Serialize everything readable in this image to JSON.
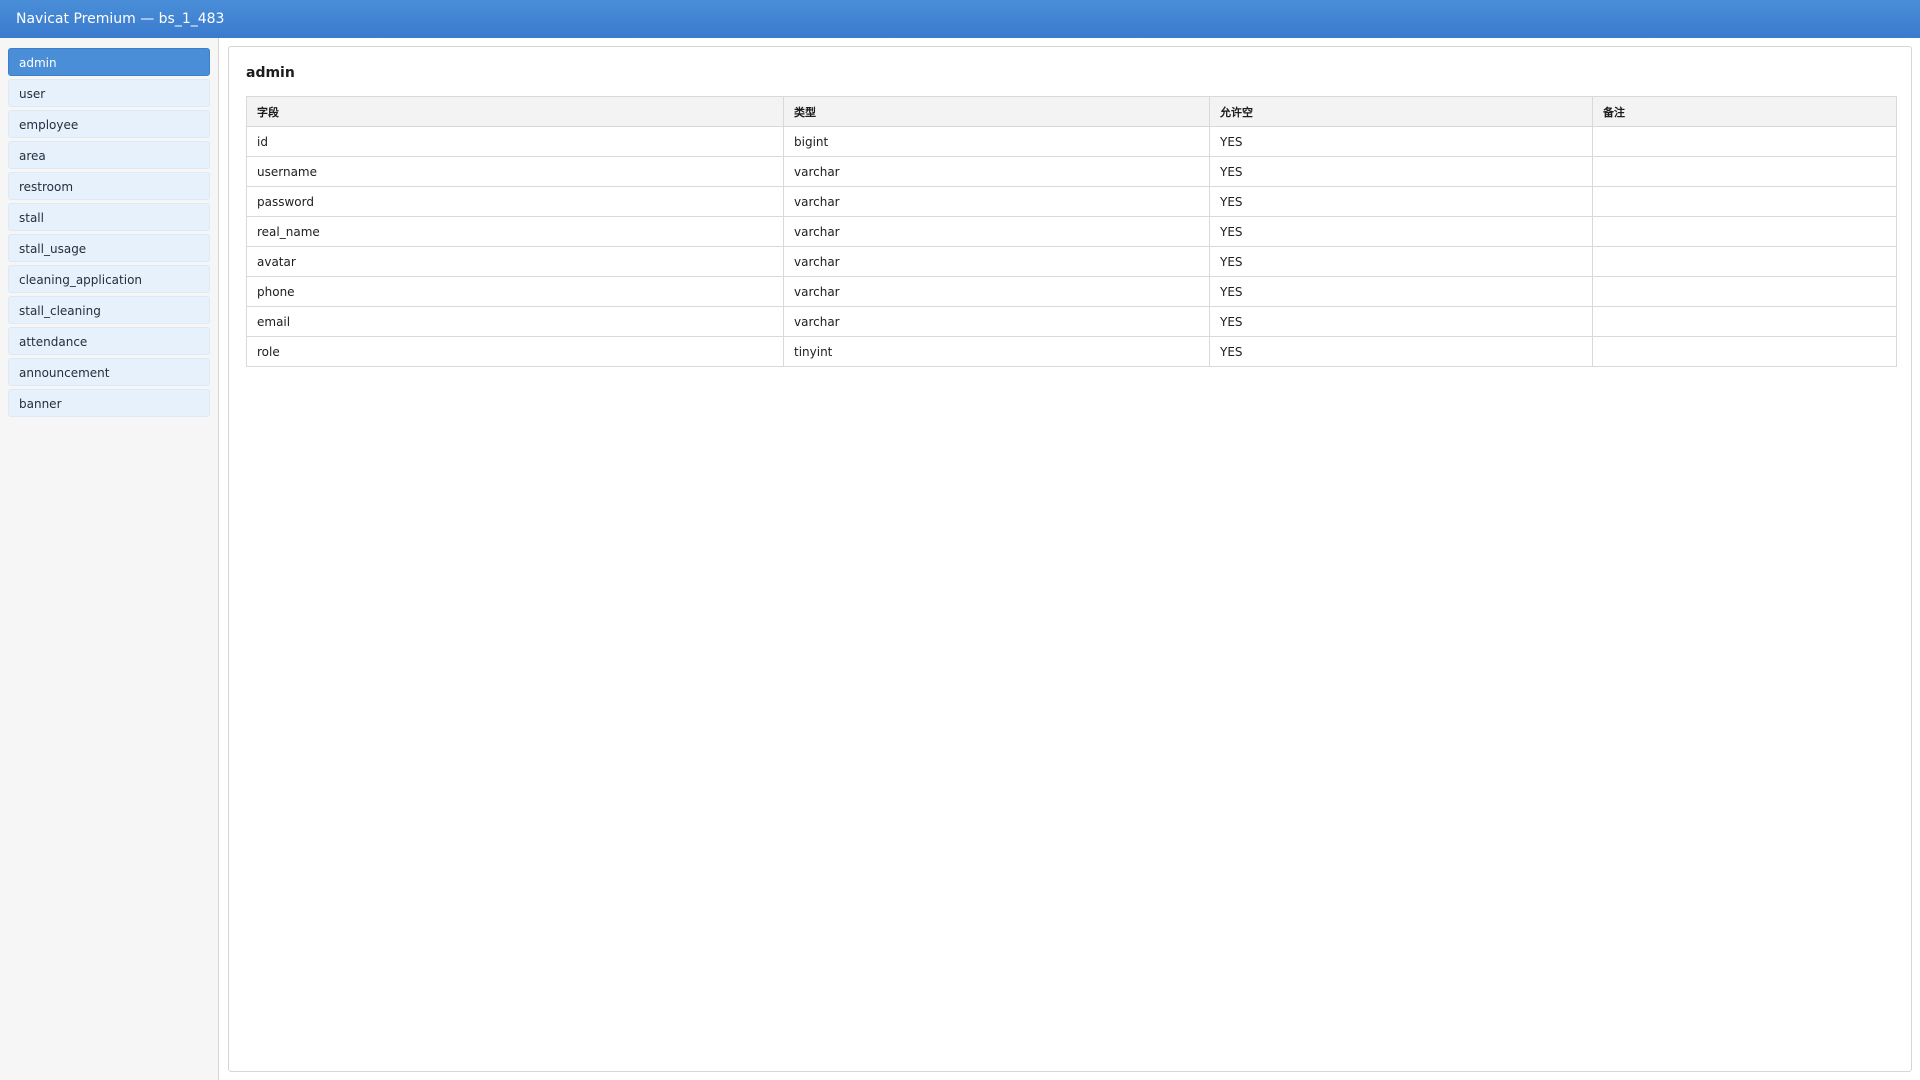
{
  "window": {
    "title": "Navicat Premium — bs_1_483"
  },
  "sidebar": {
    "items": [
      {
        "label": "admin",
        "active": true
      },
      {
        "label": "user"
      },
      {
        "label": "employee"
      },
      {
        "label": "area"
      },
      {
        "label": "restroom"
      },
      {
        "label": "stall"
      },
      {
        "label": "stall_usage"
      },
      {
        "label": "cleaning_application"
      },
      {
        "label": "stall_cleaning"
      },
      {
        "label": "attendance"
      },
      {
        "label": "announcement"
      },
      {
        "label": "banner"
      }
    ]
  },
  "main": {
    "table_name": "admin",
    "columns": [
      "字段",
      "类型",
      "允许空",
      "备注"
    ],
    "rows": [
      [
        "id",
        "bigint",
        "YES",
        ""
      ],
      [
        "username",
        "varchar",
        "YES",
        ""
      ],
      [
        "password",
        "varchar",
        "YES",
        ""
      ],
      [
        "real_name",
        "varchar",
        "YES",
        ""
      ],
      [
        "avatar",
        "varchar",
        "YES",
        ""
      ],
      [
        "phone",
        "varchar",
        "YES",
        ""
      ],
      [
        "email",
        "varchar",
        "YES",
        ""
      ],
      [
        "role",
        "tinyint",
        "YES",
        ""
      ]
    ]
  },
  "colors": {
    "accent": "#4a8ed8",
    "sidebar_item_bg": "#e6f1fb"
  }
}
